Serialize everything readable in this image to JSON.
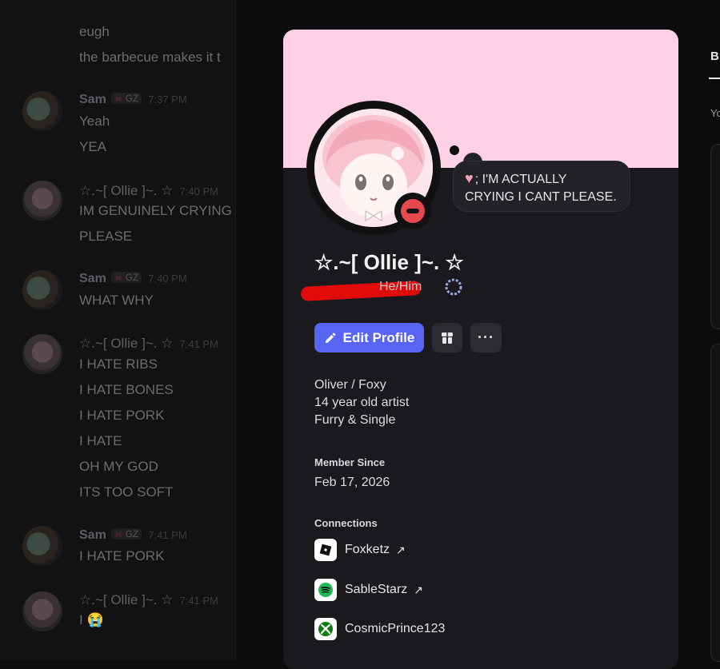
{
  "chat": {
    "messages_top": [
      {
        "text": "eugh"
      },
      {
        "text": "the barbecue makes it t"
      }
    ],
    "groups": [
      {
        "author": "Sam",
        "badge": "GZ",
        "time": "7:37 PM",
        "lines": [
          "Yeah",
          "YEA"
        ]
      },
      {
        "author": "☆.~[ Ollie ]~. ☆",
        "time": "7:40 PM",
        "lines": [
          "IM GENUINELY CRYING",
          "PLEASE"
        ]
      },
      {
        "author": "Sam",
        "badge": "GZ",
        "time": "7:40 PM",
        "lines": [
          "WHAT WHY"
        ]
      },
      {
        "author": "☆.~[ Ollie ]~. ☆",
        "time": "7:41 PM",
        "lines": [
          "I HATE RIBS",
          "I HATE BONES",
          "I HATE PORK",
          "I HATE",
          "OH MY GOD",
          "ITS TOO SOFT"
        ]
      },
      {
        "author": "Sam",
        "badge": "GZ",
        "time": "7:41 PM",
        "lines": [
          "I HATE PORK"
        ]
      },
      {
        "author": "☆.~[ Ollie ]~. ☆",
        "time": "7:41 PM",
        "lines": [
          "I 😭"
        ]
      }
    ]
  },
  "profile": {
    "banner_color": "#ffd1e5",
    "status_text": "; I'M ACTUALLY CRYING I CANT PLEASE.",
    "status_line1": "; I'M ACTUALLY",
    "status_line2": "CRYING I CANT PLEASE.",
    "display_name": "☆.~[ Ollie ]~. ☆",
    "pronouns": "He/Him",
    "buttons": {
      "edit_profile": "Edit Profile",
      "more": "···"
    },
    "bio": [
      "Oliver / Foxy",
      "14 year old artist",
      "Furry & Single"
    ],
    "member_since_label": "Member Since",
    "member_since_date": "Feb 17, 2026",
    "connections_label": "Connections",
    "connections": [
      {
        "service": "roblox-icon",
        "name": "Foxketz",
        "arrow": "↗"
      },
      {
        "service": "spotify-icon",
        "name": "SableStarz",
        "arrow": "↗"
      },
      {
        "service": "xbox-icon",
        "name": "CosmicPrince123"
      }
    ]
  },
  "right_panel": {
    "tab": "B",
    "sub": "Yo"
  },
  "colors": {
    "accent": "#5865f2",
    "dnd": "#e5484d",
    "spotify": "#1db954",
    "xbox": "#107c10"
  }
}
